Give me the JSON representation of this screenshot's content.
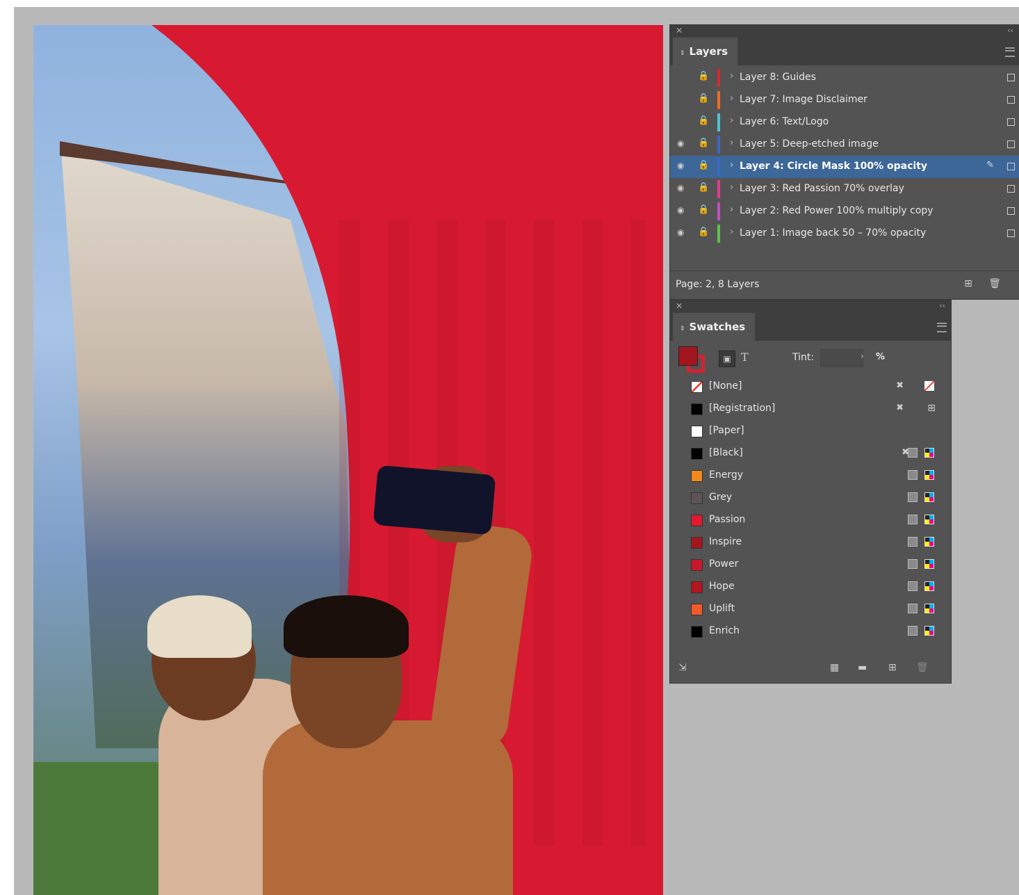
{
  "layers_panel": {
    "title": "Layers",
    "status": "Page: 2, 8 Layers",
    "layers": [
      {
        "name": "Layer 8: Guides",
        "visible": false,
        "color": "#d8272e",
        "selected": false
      },
      {
        "name": "Layer 7: Image Disclaimer",
        "visible": false,
        "color": "#f26a21",
        "selected": false
      },
      {
        "name": "Layer 6: Text/Logo",
        "visible": false,
        "color": "#4fc3d8",
        "selected": false
      },
      {
        "name": "Layer 5: Deep-etched image",
        "visible": true,
        "color": "#3b67c4",
        "selected": false
      },
      {
        "name": "Layer 4: Circle Mask 100% opacity",
        "visible": true,
        "color": "#3b67c4",
        "selected": true
      },
      {
        "name": "Layer 3: Red Passion 70% overlay",
        "visible": true,
        "color": "#e23b8f",
        "selected": false
      },
      {
        "name": "Layer 2: Red Power 100% multiply copy",
        "visible": true,
        "color": "#c14fc0",
        "selected": false
      },
      {
        "name": "Layer 1: Image back 50 – 70% opacity",
        "visible": true,
        "color": "#5cc44a",
        "selected": false
      }
    ]
  },
  "swatches_panel": {
    "title": "Swatches",
    "tint_label": "Tint:",
    "tint_value": "",
    "tint_unit": "%",
    "swatches": [
      {
        "name": "[None]",
        "chip": "none",
        "type": "none"
      },
      {
        "name": "[Registration]",
        "chip": "#000000",
        "type": "registration"
      },
      {
        "name": "[Paper]",
        "chip": "#ffffff",
        "type": "paper"
      },
      {
        "name": "[Black]",
        "chip": "#000000",
        "type": "black"
      },
      {
        "name": "Energy",
        "chip": "#f08a1c",
        "type": "process"
      },
      {
        "name": "Grey",
        "chip": "#5e5456",
        "type": "process"
      },
      {
        "name": "Passion",
        "chip": "#e0192f",
        "type": "process"
      },
      {
        "name": "Inspire",
        "chip": "#a3161f",
        "type": "process"
      },
      {
        "name": "Power",
        "chip": "#c8182b",
        "type": "process"
      },
      {
        "name": "Hope",
        "chip": "#b5151f",
        "type": "process"
      },
      {
        "name": "Uplift",
        "chip": "#f05a2b",
        "type": "process"
      },
      {
        "name": "Enrich",
        "chip": "#000000",
        "type": "process"
      }
    ]
  }
}
